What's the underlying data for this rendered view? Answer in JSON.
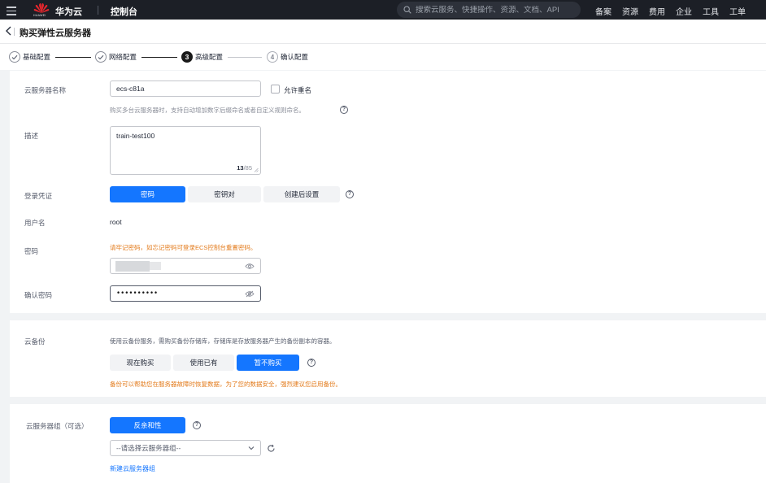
{
  "topbar": {
    "logo_text": "HUAWEI",
    "brand": "华为云",
    "console": "控制台",
    "search_placeholder": "搜索云服务、快捷操作、资源、文档、API",
    "nav": [
      "备案",
      "资源",
      "费用",
      "企业",
      "工具",
      "工单"
    ]
  },
  "page": {
    "title": "购买弹性云服务器"
  },
  "steps": [
    {
      "label": "基础配置",
      "state": "done"
    },
    {
      "label": "网络配置",
      "state": "done"
    },
    {
      "num": "3",
      "label": "高级配置",
      "state": "active"
    },
    {
      "num": "4",
      "label": "确认配置",
      "state": "todo"
    }
  ],
  "form": {
    "server_name": {
      "label": "云服务器名称",
      "value": "ecs-c81a",
      "allow_duplicate_label": "允许重名",
      "allow_duplicate_checked": false,
      "hint": "购买多台云服务器时，支持自动增加数字后缀命名或者自定义规则命名。"
    },
    "description": {
      "label": "描述",
      "value": "train-test100",
      "count": "13",
      "max": "/85"
    },
    "login": {
      "label": "登录凭证",
      "options": [
        "密码",
        "密钥对",
        "创建后设置"
      ],
      "selected": "密码"
    },
    "username": {
      "label": "用户名",
      "value": "root"
    },
    "password": {
      "label": "密码",
      "warning": "请牢记密码，如忘记密码可登录ECS控制台重置密码。"
    },
    "confirm_password": {
      "label": "确认密码",
      "value": "••••••••••"
    }
  },
  "backup": {
    "label": "云备份",
    "description": "使用云备份服务，需购买备份存储库，存储库是存放服务器产生的备份副本的容器。",
    "options": [
      "现在购买",
      "使用已有",
      "暂不购买"
    ],
    "selected": "暂不购买",
    "warning": "备份可以帮助您在服务器故障时恢复数据，为了您的数据安全，强烈建议您启用备份。"
  },
  "server_group": {
    "label": "云服务器组（可选）",
    "option": "反亲和性",
    "select_placeholder": "--请选择云服务器组--",
    "create_link": "新建云服务器组"
  },
  "colors": {
    "primary": "#1476ff",
    "warning": "#e37b1c",
    "topbar": "#1c1f26",
    "huawei_red": "#e8262d"
  }
}
